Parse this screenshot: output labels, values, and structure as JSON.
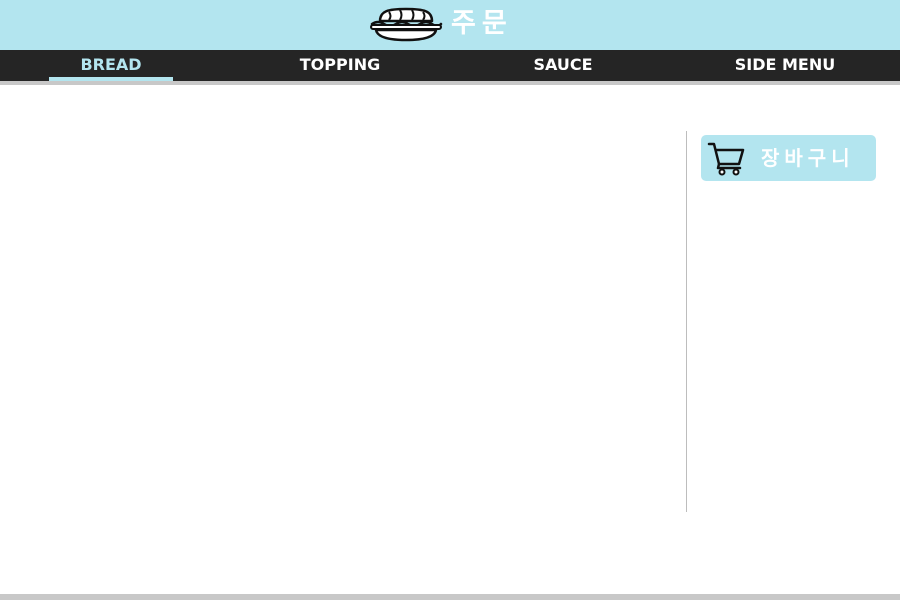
{
  "header": {
    "title": "주문",
    "logo_icon": "sandwich-icon"
  },
  "nav": {
    "tabs": [
      {
        "label": "BREAD",
        "active": true
      },
      {
        "label": "TOPPING",
        "active": false
      },
      {
        "label": "SAUCE",
        "active": false
      },
      {
        "label": "SIDE MENU",
        "active": false
      }
    ]
  },
  "sidebar": {
    "cart_label": "장바구니",
    "cart_icon": "shopping-cart-icon"
  },
  "colors": {
    "accent": "#b3e5ef",
    "nav_background": "#252525",
    "divider": "#c8c8c8"
  }
}
